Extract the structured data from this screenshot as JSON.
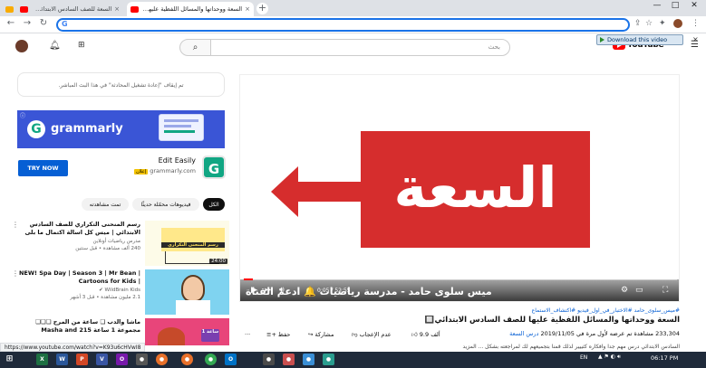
{
  "browser": {
    "tabs": [
      {
        "title": "السعة ووحداتها والمسائل اللفظية عليها للصف",
        "active": true,
        "favicon": "youtube-favicon"
      },
      {
        "title": "السعة للصف السادس الابتدائي - يحلّ موقف",
        "active": false,
        "favicon": "youtube-favicon"
      },
      {
        "title": "",
        "active": false,
        "favicon": "doc-favicon"
      }
    ],
    "new_tab": "+",
    "address": "",
    "window_controls": [
      "—",
      "□",
      "✕"
    ]
  },
  "download_helper": {
    "label": "Download this video",
    "close": "×"
  },
  "youtube": {
    "logo_word": "YouTube",
    "search_placeholder": "بحث",
    "masthead_icons": [
      "create-icon",
      "bell-icon",
      "profile-avatar"
    ]
  },
  "player": {
    "board_title": "السعة",
    "overlay_text": "ميس سلوى حامد - مدرسة رياضيات 🔔 ادعم القناة",
    "time_current": "0:05",
    "time_total": "52:55",
    "progress_fraction": 0.02,
    "accent": "#d62d2d"
  },
  "video": {
    "hashtags": "#ميس_سلوى_حامد #الاختبار_في_اول_فيديو #اكتشاف_الاستماع",
    "title": "السعة ووحداتها والمسائل اللفظية عليها للصف السادس الابتدائي🔲",
    "views": "233,304 مشاهدة",
    "date": "2019/11/05",
    "views_date_rest": "تم عرضه لأول مرة في",
    "channel_tag": "درس السعة",
    "description": "السادس الابتدائي درس مهم جدا وافكاره كثييير لذلك قمنا بتجميعهم لك لمراجعته بشكل ... المزيد",
    "actions": [
      {
        "label": "9.9 ألف",
        "icon": "like-icon"
      },
      {
        "label": "عدم الإعجاب",
        "icon": "dislike-icon"
      },
      {
        "label": "مشاركة",
        "icon": "share-icon"
      },
      {
        "label": "حفظ",
        "icon": "save-icon"
      }
    ],
    "more": "···"
  },
  "sidebar": {
    "chat_notice": "تم إيقاف \"إعادة تشغيل المحادثة\" في هذا البث المباشر.",
    "ad": {
      "brand": "grammarly",
      "cta": "TRY NOW",
      "name": "Edit Easily",
      "domain": "grammarly.com",
      "badge": "إعلان",
      "info": "ⓘ"
    },
    "chips": [
      {
        "label": "الكل",
        "active": true
      },
      {
        "label": "فيديوهات محمّلة حديثًا",
        "active": false
      },
      {
        "label": "تمت مشاهدته",
        "active": false
      }
    ],
    "recommendations": [
      {
        "title": "رسم المنحنى التكراري للصف السادس الابتدائي | ميس كل اسالة اكتمال ما بلى بتاريه",
        "channel": "مدرس رياضيات أونلاين",
        "stats": "240 ألف مشاهدة • قبل سنتين",
        "duration": "24:00",
        "thumb_caption": "رسم المنحنى التكراري"
      },
      {
        "title": "NEW! Spa Day | Season 3 | Mr Bean | Cartoons for Kids |",
        "channel": "WildBrain Kids",
        "stats": "2.1 مليون مشاهدة • قبل 3 أشهر",
        "duration": "",
        "thumb_caption": ""
      },
      {
        "title": "ماشا والدب ❏ ساعة من المرح ❏❏❏ مجموعة 1 ساعة 215 Masha and the❏❏❏",
        "channel": "",
        "stats": "",
        "duration": "",
        "thumb_caption": "1 ساعة"
      }
    ]
  },
  "status_url": "https://www.youtube.com/watch?v=K93u6cHVwI8",
  "taskbar": {
    "lang": "EN",
    "clock": "06:17 PM",
    "apps": [
      "X",
      "W",
      "P",
      "V",
      "O",
      "●",
      "●",
      "●",
      "●",
      "O",
      "●",
      "●",
      "●",
      "●"
    ]
  }
}
